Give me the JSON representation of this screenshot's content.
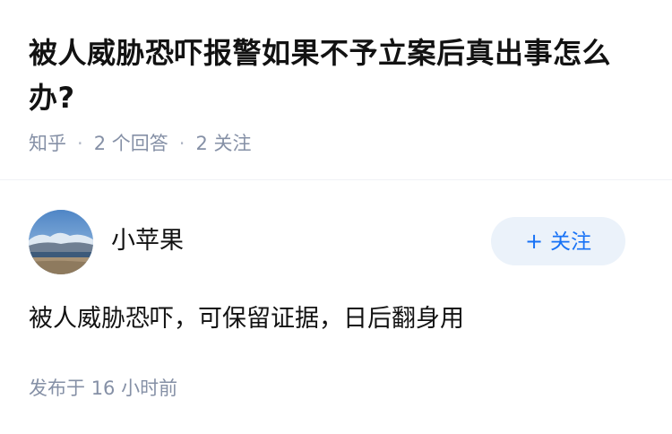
{
  "question": {
    "title": "被人威胁恐吓报警如果不予立案后真出事怎么办?",
    "source": "知乎",
    "answer_count": "2",
    "answer_unit": "个回答",
    "follower_count": "2",
    "follower_unit": "关注",
    "separator": "·"
  },
  "answer": {
    "author": {
      "name": "小苹果",
      "avatar_icon": "landscape-avatar-icon"
    },
    "follow_button": {
      "plus": "+",
      "label": "关注"
    },
    "content": "被人威胁恐吓，可保留证据，日后翻身用",
    "posted_prefix": "发布于",
    "posted_time": "16 小时前"
  },
  "colors": {
    "text_primary": "#121212",
    "text_secondary": "#8590a6",
    "accent": "#1772f6",
    "follow_bg": "#ebf2fa",
    "divider": "#f0f2f5"
  }
}
